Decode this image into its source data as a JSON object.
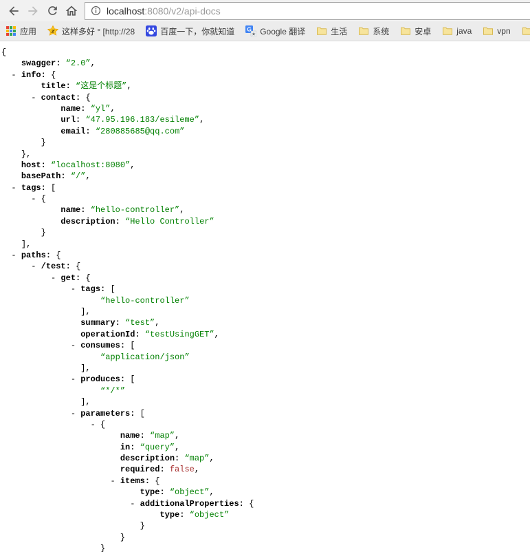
{
  "browser": {
    "url_host": "localhost",
    "url_rest": ":8080/v2/api-docs"
  },
  "colors": {
    "json_key": "#000000",
    "json_string": "#008000",
    "json_boolean": "#a52a2a",
    "toolbar_bg": "#f1f1f1",
    "bookmarks_bg": "#ececec"
  },
  "bookmarks": {
    "items": [
      {
        "icon": "apps-grid-icon",
        "label": "应用"
      },
      {
        "icon": "star-icon",
        "label": "这样多好 ° [http://28"
      },
      {
        "icon": "baidu-icon",
        "label": "百度一下，你就知道"
      },
      {
        "icon": "translate-icon",
        "label": "Google 翻译"
      },
      {
        "icon": "folder-icon",
        "label": "生活"
      },
      {
        "icon": "folder-icon",
        "label": "系统"
      },
      {
        "icon": "folder-icon",
        "label": "安卓"
      },
      {
        "icon": "folder-icon",
        "label": "java"
      },
      {
        "icon": "folder-icon",
        "label": "vpn"
      },
      {
        "icon": "folder-icon",
        "label": ""
      }
    ]
  },
  "json_viewer": {
    "lines": [
      {
        "i": 0,
        "t": [
          [
            "p",
            "{"
          ]
        ]
      },
      {
        "i": 4,
        "t": [
          [
            "k",
            "swagger"
          ],
          [
            "s",
            "2.0"
          ],
          [
            "p",
            ","
          ]
        ]
      },
      {
        "i": 4,
        "d": true,
        "t": [
          [
            "k",
            "info"
          ],
          [
            "p",
            "{"
          ]
        ]
      },
      {
        "i": 8,
        "t": [
          [
            "k",
            "title"
          ],
          [
            "s",
            "这是个标题"
          ],
          [
            "p",
            ","
          ]
        ]
      },
      {
        "i": 8,
        "d": true,
        "t": [
          [
            "k",
            "contact"
          ],
          [
            "p",
            "{"
          ]
        ]
      },
      {
        "i": 12,
        "t": [
          [
            "k",
            "name"
          ],
          [
            "s",
            "yl"
          ],
          [
            "p",
            ","
          ]
        ]
      },
      {
        "i": 12,
        "t": [
          [
            "k",
            "url"
          ],
          [
            "s",
            "47.95.196.183/esileme"
          ],
          [
            "p",
            ","
          ]
        ]
      },
      {
        "i": 12,
        "t": [
          [
            "k",
            "email"
          ],
          [
            "s",
            "280885685@qq.com"
          ]
        ]
      },
      {
        "i": 8,
        "t": [
          [
            "p",
            "}"
          ]
        ]
      },
      {
        "i": 4,
        "t": [
          [
            "p",
            "},"
          ]
        ]
      },
      {
        "i": 4,
        "t": [
          [
            "k",
            "host"
          ],
          [
            "s",
            "localhost:8080"
          ],
          [
            "p",
            ","
          ]
        ]
      },
      {
        "i": 4,
        "t": [
          [
            "k",
            "basePath"
          ],
          [
            "s",
            "/"
          ],
          [
            "p",
            ","
          ]
        ]
      },
      {
        "i": 4,
        "d": true,
        "t": [
          [
            "k",
            "tags"
          ],
          [
            "p",
            "["
          ]
        ]
      },
      {
        "i": 8,
        "d": true,
        "t": [
          [
            "p",
            "{"
          ]
        ]
      },
      {
        "i": 12,
        "t": [
          [
            "k",
            "name"
          ],
          [
            "s",
            "hello-controller"
          ],
          [
            "p",
            ","
          ]
        ]
      },
      {
        "i": 12,
        "t": [
          [
            "k",
            "description"
          ],
          [
            "s",
            "Hello Controller"
          ]
        ]
      },
      {
        "i": 8,
        "t": [
          [
            "p",
            "}"
          ]
        ]
      },
      {
        "i": 4,
        "t": [
          [
            "p",
            "],"
          ]
        ]
      },
      {
        "i": 4,
        "d": true,
        "t": [
          [
            "k",
            "paths"
          ],
          [
            "p",
            "{"
          ]
        ]
      },
      {
        "i": 8,
        "d": true,
        "t": [
          [
            "k",
            "/test"
          ],
          [
            "p",
            "{"
          ]
        ]
      },
      {
        "i": 12,
        "d": true,
        "t": [
          [
            "k",
            "get"
          ],
          [
            "p",
            "{"
          ]
        ]
      },
      {
        "i": 16,
        "d": true,
        "t": [
          [
            "k",
            "tags"
          ],
          [
            "p",
            "["
          ]
        ]
      },
      {
        "i": 20,
        "t": [
          [
            "s",
            "hello-controller"
          ]
        ]
      },
      {
        "i": 16,
        "t": [
          [
            "p",
            "],"
          ]
        ]
      },
      {
        "i": 16,
        "t": [
          [
            "k",
            "summary"
          ],
          [
            "s",
            "test"
          ],
          [
            "p",
            ","
          ]
        ]
      },
      {
        "i": 16,
        "t": [
          [
            "k",
            "operationId"
          ],
          [
            "s",
            "testUsingGET"
          ],
          [
            "p",
            ","
          ]
        ]
      },
      {
        "i": 16,
        "d": true,
        "t": [
          [
            "k",
            "consumes"
          ],
          [
            "p",
            "["
          ]
        ]
      },
      {
        "i": 20,
        "t": [
          [
            "s",
            "application/json"
          ]
        ]
      },
      {
        "i": 16,
        "t": [
          [
            "p",
            "],"
          ]
        ]
      },
      {
        "i": 16,
        "d": true,
        "t": [
          [
            "k",
            "produces"
          ],
          [
            "p",
            "["
          ]
        ]
      },
      {
        "i": 20,
        "t": [
          [
            "s",
            "*/*"
          ]
        ]
      },
      {
        "i": 16,
        "t": [
          [
            "p",
            "],"
          ]
        ]
      },
      {
        "i": 16,
        "d": true,
        "t": [
          [
            "k",
            "parameters"
          ],
          [
            "p",
            "["
          ]
        ]
      },
      {
        "i": 20,
        "d": true,
        "t": [
          [
            "p",
            "{"
          ]
        ]
      },
      {
        "i": 24,
        "t": [
          [
            "k",
            "name"
          ],
          [
            "s",
            "map"
          ],
          [
            "p",
            ","
          ]
        ]
      },
      {
        "i": 24,
        "t": [
          [
            "k",
            "in"
          ],
          [
            "s",
            "query"
          ],
          [
            "p",
            ","
          ]
        ]
      },
      {
        "i": 24,
        "t": [
          [
            "k",
            "description"
          ],
          [
            "s",
            "map"
          ],
          [
            "p",
            ","
          ]
        ]
      },
      {
        "i": 24,
        "t": [
          [
            "k",
            "required"
          ],
          [
            "b",
            "false"
          ],
          [
            "p",
            ","
          ]
        ]
      },
      {
        "i": 24,
        "d": true,
        "t": [
          [
            "k",
            "items"
          ],
          [
            "p",
            "{"
          ]
        ]
      },
      {
        "i": 28,
        "t": [
          [
            "k",
            "type"
          ],
          [
            "s",
            "object"
          ],
          [
            "p",
            ","
          ]
        ]
      },
      {
        "i": 28,
        "d": true,
        "t": [
          [
            "k",
            "additionalProperties"
          ],
          [
            "p",
            "{"
          ]
        ]
      },
      {
        "i": 32,
        "t": [
          [
            "k",
            "type"
          ],
          [
            "s",
            "object"
          ]
        ]
      },
      {
        "i": 28,
        "t": [
          [
            "p",
            "}"
          ]
        ]
      },
      {
        "i": 24,
        "t": [
          [
            "p",
            "}"
          ]
        ]
      },
      {
        "i": 20,
        "t": [
          [
            "p",
            "}"
          ]
        ]
      }
    ]
  }
}
